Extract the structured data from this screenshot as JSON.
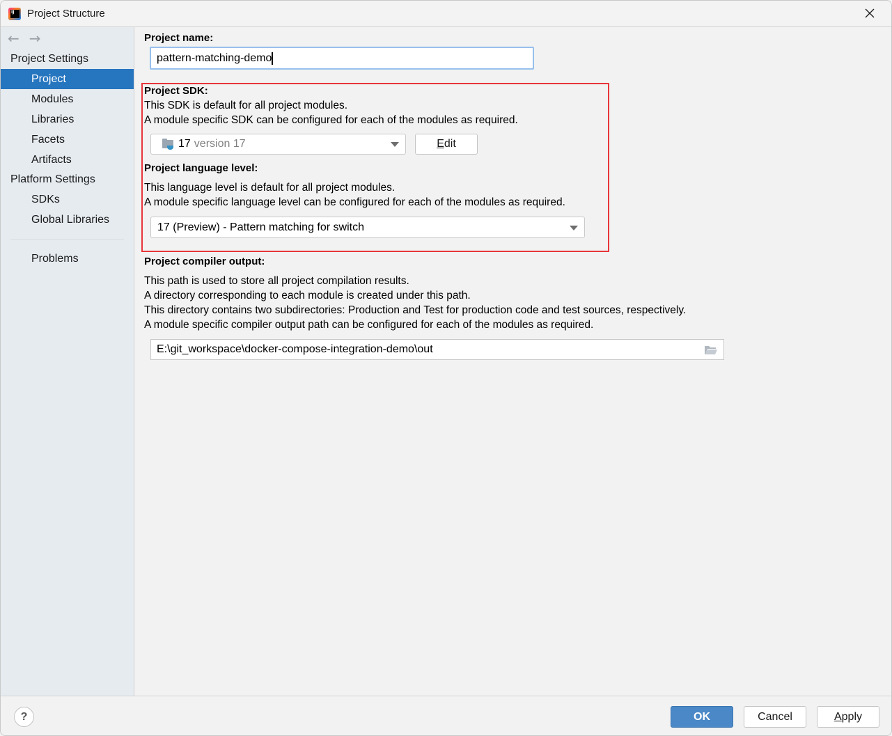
{
  "window": {
    "title": "Project Structure",
    "close_icon": "close-icon",
    "app_icon": "intellij-idea-icon"
  },
  "sidebar": {
    "back_icon": "←",
    "forward_icon": "→",
    "sections": [
      {
        "header": "Project Settings",
        "items": [
          {
            "label": "Project",
            "selected": true
          },
          {
            "label": "Modules"
          },
          {
            "label": "Libraries"
          },
          {
            "label": "Facets"
          },
          {
            "label": "Artifacts"
          }
        ]
      },
      {
        "header": "Platform Settings",
        "items": [
          {
            "label": "SDKs"
          },
          {
            "label": "Global Libraries"
          }
        ]
      }
    ],
    "problems": "Problems"
  },
  "main": {
    "project_name": {
      "label": "Project name:",
      "value": "pattern-matching-demo"
    },
    "sdk": {
      "label": "Project SDK:",
      "desc1": "This SDK is default for all project modules.",
      "desc2": "A module specific SDK can be configured for each of the modules as required.",
      "selected_name": "17",
      "selected_version": "version 17",
      "edit_label_first": "E",
      "edit_label_rest": "dit"
    },
    "language_level": {
      "label": "Project language level:",
      "desc1": "This language level is default for all project modules.",
      "desc2": "A module specific language level can be configured for each of the modules as required.",
      "selected": "17 (Preview) - Pattern matching for switch"
    },
    "compiler_output": {
      "label": "Project compiler output:",
      "desc1": "This path is used to store all project compilation results.",
      "desc2": "A directory corresponding to each module is created under this path.",
      "desc3": "This directory contains two subdirectories: Production and Test for production code and test sources, respectively.",
      "desc4": "A module specific compiler output path can be configured for each of the modules as required.",
      "path": "E:\\git_workspace\\docker-compose-integration-demo\\out"
    }
  },
  "footer": {
    "help": "?",
    "ok": "OK",
    "cancel": "Cancel",
    "apply_first": "A",
    "apply_rest": "pply"
  },
  "colors": {
    "selection": "#2675bf",
    "highlight_box": "#e8363b",
    "primary_button": "#4a88c7",
    "focus_ring": "#97c0ec"
  }
}
